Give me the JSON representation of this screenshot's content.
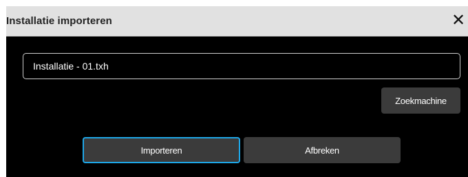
{
  "dialog": {
    "title": "Installatie importeren",
    "close_glyph": "✕"
  },
  "file": {
    "value": "Installatie - 01.txh"
  },
  "buttons": {
    "search": "Zoekmachine",
    "import": "Importeren",
    "cancel": "Afbreken"
  },
  "colors": {
    "titlebar": "#e1e1e1",
    "dialog_bg": "#000000",
    "button_bg": "#3b3b3b",
    "focus_accent": "#1ea7e8"
  }
}
